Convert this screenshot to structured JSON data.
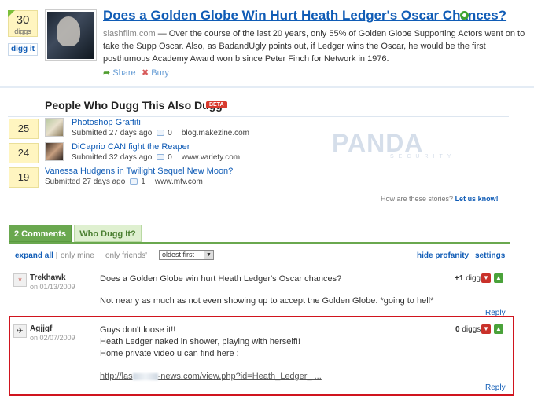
{
  "story": {
    "digg_count": "30",
    "digg_unit": "diggs",
    "digg_button": "digg it",
    "title": "Does a Golden Globe Win Hurt Heath Ledger's Oscar Chances?",
    "source": "slashfilm.com",
    "description": "— Over the course of the last 20 years, only 55% of Golden Globe Supporting Actors went on to take the Supp Oscar. Also, as BadandUgly points out, if Ledger wins the Oscar, he would be the first posthumous Academy Award won b since Peter Finch for Network in 1976.",
    "share_label": "Share",
    "bury_label": "Bury"
  },
  "related": {
    "heading": "People Who Dugg This Also Dugg",
    "beta_badge": "BETA",
    "items": [
      {
        "count": "25",
        "title": "Photoshop Graffiti",
        "submitted": "Submitted 27 days ago",
        "comments": "0",
        "domain": "blog.makezine.com"
      },
      {
        "count": "24",
        "title": "DiCaprio CAN fight the Reaper",
        "submitted": "Submitted 32 days ago",
        "comments": "0",
        "domain": "www.variety.com"
      },
      {
        "count": "19",
        "title": "Vanessa Hudgens in Twilight Sequel New Moon?",
        "submitted": "Submitted 27 days ago",
        "comments": "1",
        "domain": "www.mtv.com"
      }
    ],
    "watermark": "PANDA",
    "watermark_sub": "SECURITY",
    "feedback_question": "How are these stories?",
    "feedback_link": "Let us know!"
  },
  "tabs": [
    {
      "label": "2 Comments"
    },
    {
      "label": "Who Dugg It?"
    }
  ],
  "filters": {
    "expand_all": "expand all",
    "only_mine": "only mine",
    "only_friends": "only friends'",
    "sort_selected": "oldest first",
    "hide_profanity": "hide profanity",
    "settings": "settings"
  },
  "comments": [
    {
      "author": "Trekhawk",
      "date": "on 01/13/2009",
      "digg_score": "+1",
      "digg_unit": "digg",
      "lines": [
        "Does a Golden Globe win hurt Heath Ledger's Oscar chances?",
        "Not nearly as much as not even showing up to accept the Golden Globe. *going to hell*"
      ],
      "reply": "Reply"
    },
    {
      "author": "Agjjgf",
      "date": "on 02/07/2009",
      "digg_score": "0",
      "digg_unit": "diggs",
      "lines": [
        "Guys don't loose it!!",
        "Heath Ledger naked in shower, playing with herself!!",
        "Home private video u can find here :"
      ],
      "link_prefix": "http://las",
      "link_suffix": "-news.com/view.php?id=Heath_Ledger_ ...",
      "reply": "Reply"
    }
  ],
  "colors": {
    "link": "#105cb6",
    "digg_yellow": "#fff5c0",
    "tab_green": "#6aa84f",
    "highlight_red": "#d0141e"
  }
}
